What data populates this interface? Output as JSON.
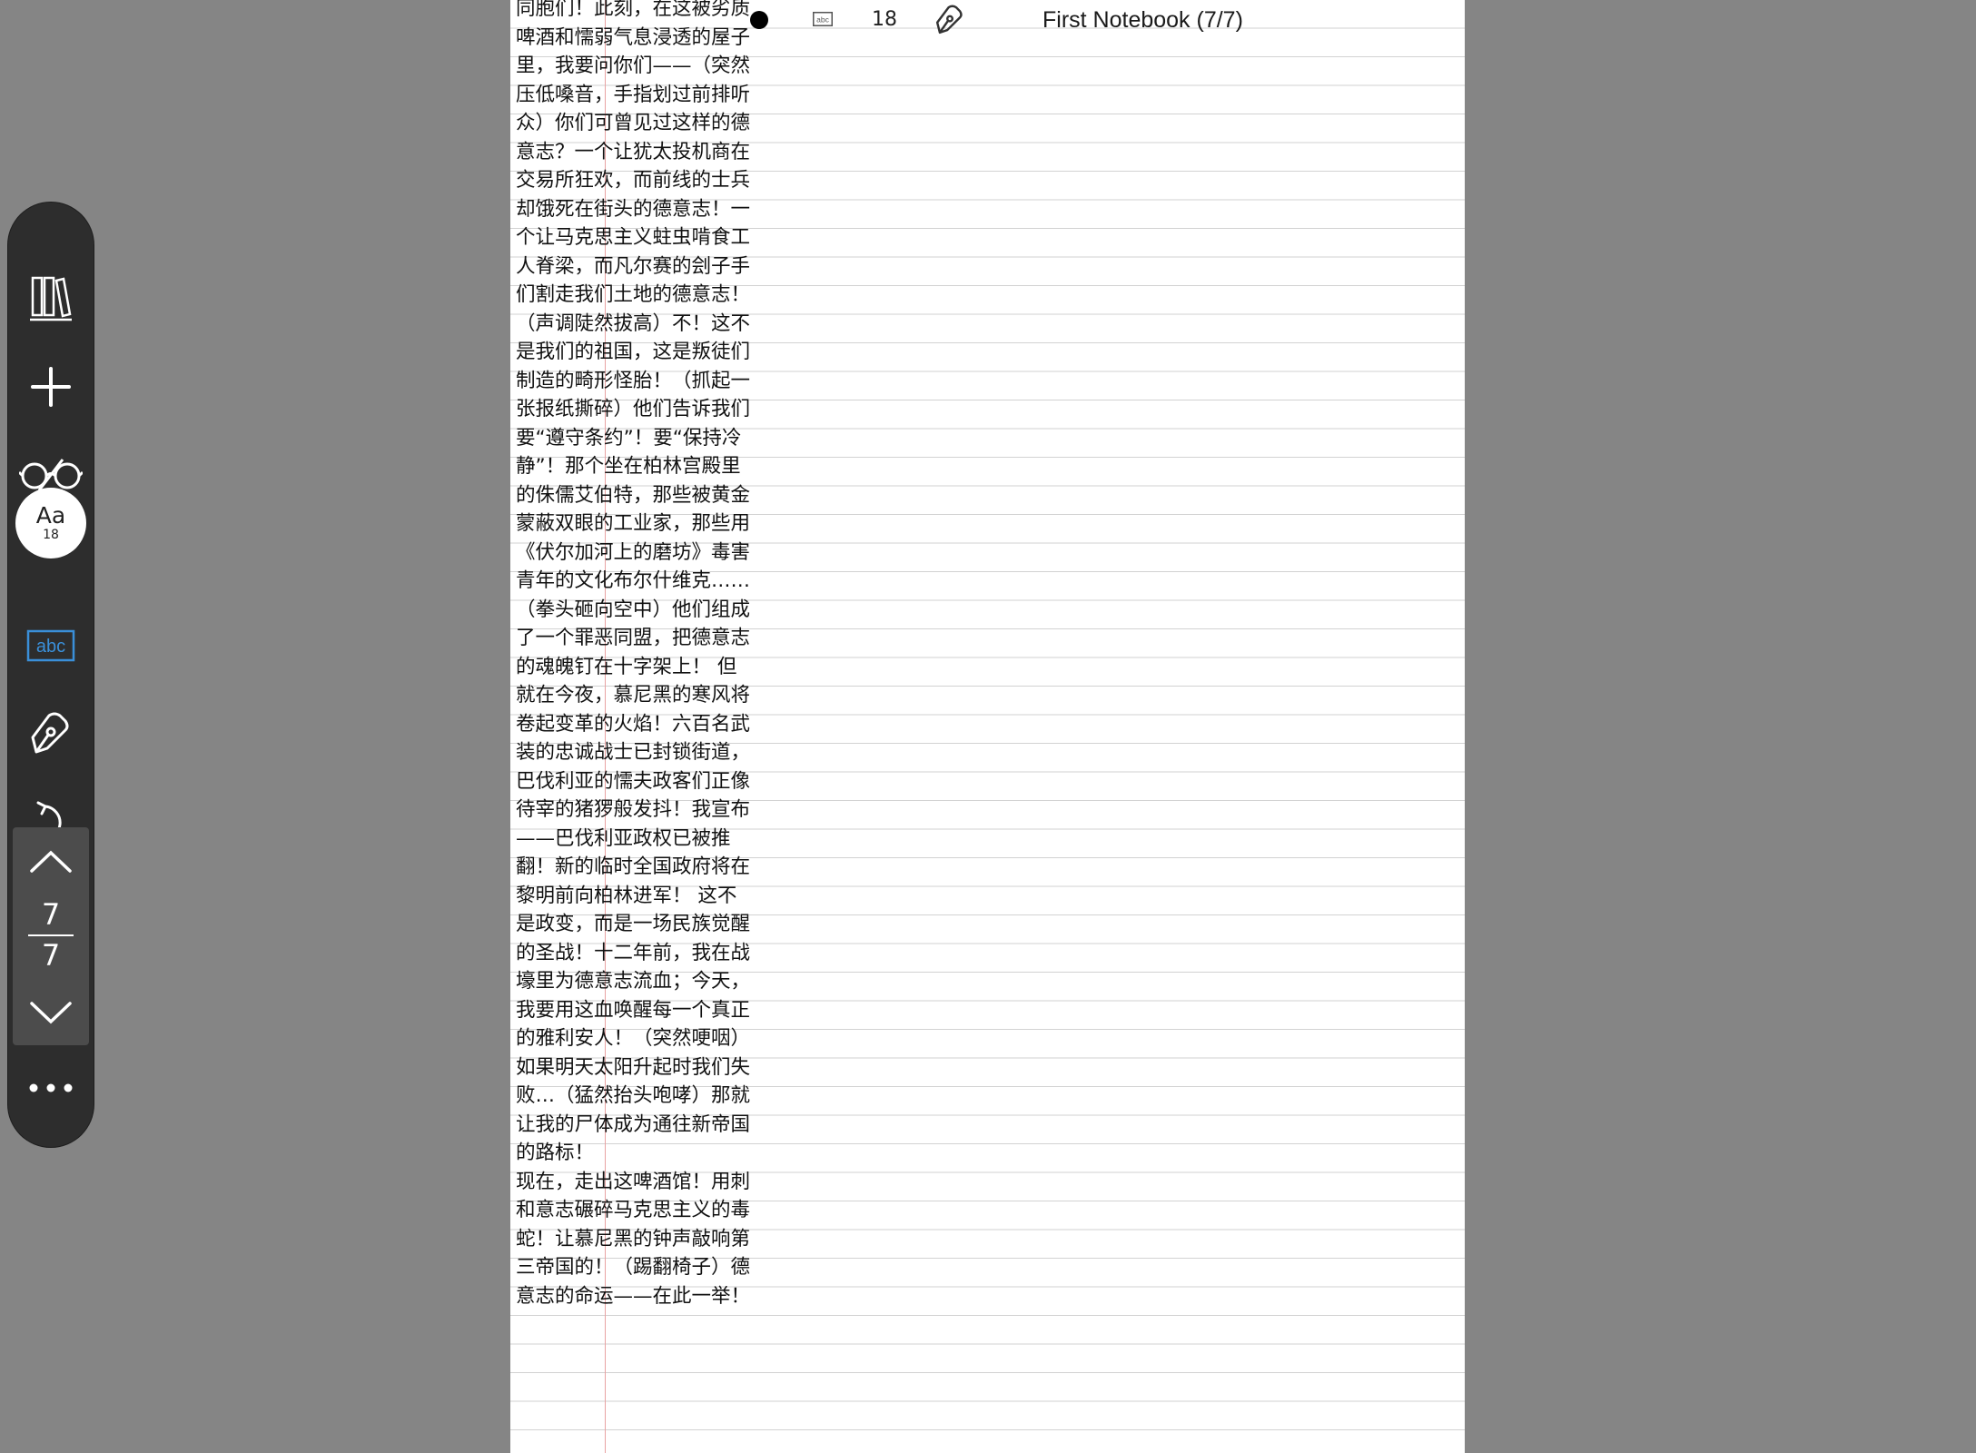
{
  "toolbar": {
    "library_icon": "bookshelf-icon",
    "add_icon": "plus-icon",
    "read_icon": "glasses-icon",
    "font_button": {
      "label": "Aa",
      "size": "18"
    },
    "text_mode_icon": "abc-icon",
    "text_mode_label": "abc",
    "pen_icon": "pen-nib-icon",
    "undo_icon": "undo-icon",
    "page_nav": {
      "current": "7",
      "total": "7"
    },
    "more_icon": "more-dots-icon",
    "accent_color": "#3a8fd9"
  },
  "header": {
    "status_icon": "filled-dot",
    "abc_icon": "abc-icon",
    "abc_label": "abc",
    "font_size": "18",
    "pen_icon": "pen-nib-icon",
    "notebook_title": "First Notebook (7/7)"
  },
  "page": {
    "text": "同胞们！此刻，在这被劣质啤酒和懦弱气息浸透的屋子里，我要问你们——（突然压低嗓音，手指划过前排听众）你们可曾见过这样的德意志？一个让犹太投机商在交易所狂欢，而前线的士兵却饿死在街头的德意志！一个让马克思主义蛀虫啃食工人脊梁，而凡尔赛的刽子手们割走我们土地的德意志！（声调陡然拔高）不！这不是我们的祖国，这是叛徒们制造的畸形怪胎！（抓起一张报纸撕碎）他们告诉我们要“遵守条约”！要“保持冷静”！那个坐在柏林宫殿里的侏儒艾伯特，那些被黄金蒙蔽双眼的工业家，那些用《伏尔加河上的磨坊》毒害青年的文化布尔什维克……（拳头砸向空中）他们组成了一个罪恶同盟，把德意志的魂魄钉在十字架上！ 但就在今夜，慕尼黑的寒风将卷起变革的火焰！六百名武装的忠诚战士已封锁街道，巴伐利亚的懦夫政客们正像待宰的猪猡般发抖！我宣布——巴伐利亚政权已被推翻！新的临时全国政府将在黎明前向柏林进军！ 这不是政变，而是一场民族觉醒的圣战！十二年前，我在战壕里为德意志流血；今天，我要用这血唤醒每一个真正的雅利安人！（突然哽咽）如果明天太阳升起时我们失败…（猛然抬头咆哮）那就让我的尸体成为通往新帝国的路标！\n现在，走出这啤酒馆！用刺和意志碾碎马克思主义的毒蛇！让慕尼黑的钟声敲响第三帝国的！（踢翻椅子）德意志的命运——在此一举！"
  }
}
